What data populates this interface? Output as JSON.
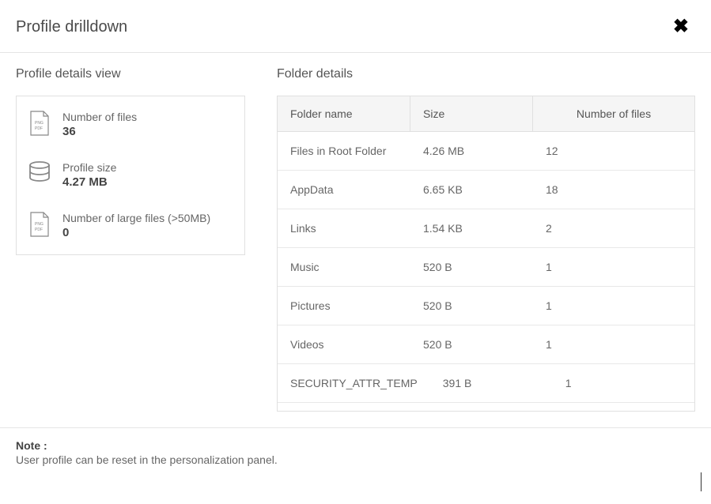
{
  "header": {
    "title": "Profile drilldown"
  },
  "profile_details": {
    "title": "Profile details view",
    "stats": [
      {
        "label": "Number of files",
        "value": "36"
      },
      {
        "label": "Profile size",
        "value": "4.27 MB"
      },
      {
        "label": "Number of large files (>50MB)",
        "value": "0"
      }
    ]
  },
  "folder_details": {
    "title": "Folder details",
    "columns": {
      "folder": "Folder name",
      "size": "Size",
      "count": "Number of files"
    },
    "rows": [
      {
        "folder": "Files in Root Folder",
        "size": "4.26 MB",
        "count": "12"
      },
      {
        "folder": "AppData",
        "size": "6.65 KB",
        "count": "18"
      },
      {
        "folder": "Links",
        "size": "1.54 KB",
        "count": "2"
      },
      {
        "folder": "Music",
        "size": "520 B",
        "count": "1"
      },
      {
        "folder": "Pictures",
        "size": "520 B",
        "count": "1"
      },
      {
        "folder": "Videos",
        "size": "520 B",
        "count": "1"
      },
      {
        "folder": "SECURITY_ATTR_TEMP",
        "size": "391 B",
        "count": "1"
      }
    ]
  },
  "footer": {
    "note_label": "Note :",
    "note_text": "User profile can be reset in the personalization panel."
  }
}
